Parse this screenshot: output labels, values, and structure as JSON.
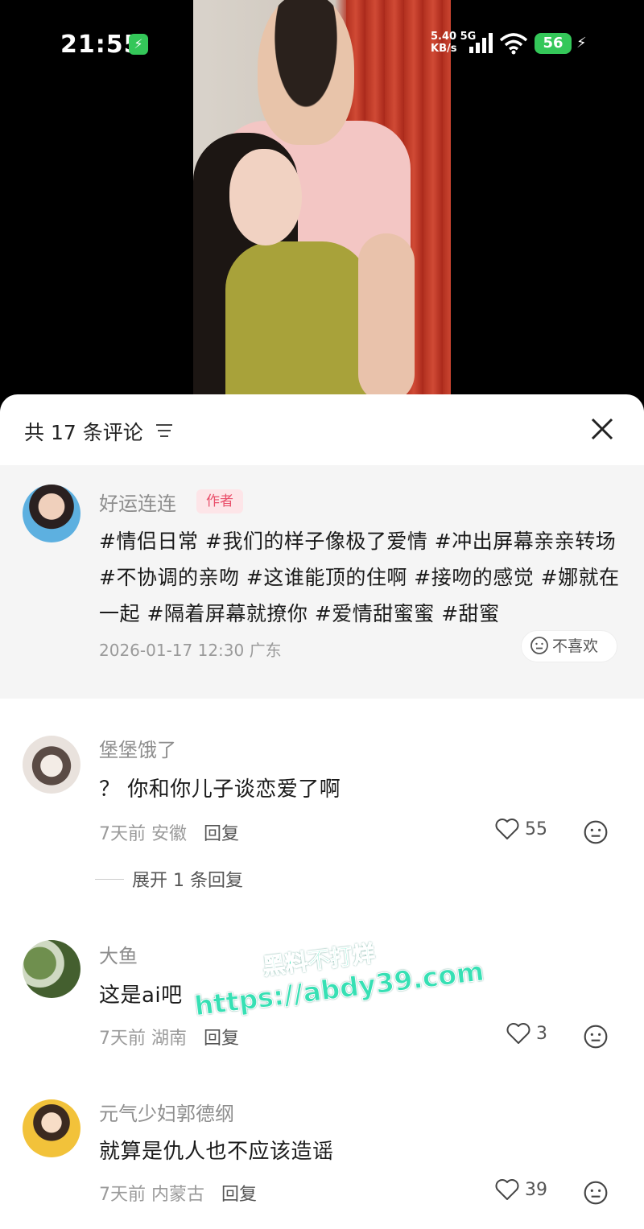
{
  "status_bar": {
    "time": "21:55",
    "charge_glyph": "⚡",
    "net_speed_value": "5.40",
    "net_speed_unit": "KB/s",
    "net_type": "5G",
    "battery": "56",
    "icons": [
      "charging-icon",
      "signal-icon",
      "wifi-icon",
      "battery-icon",
      "bolt-icon"
    ]
  },
  "video": {
    "description_icon": "video-frame"
  },
  "panel": {
    "title": "共 17 条评论",
    "sort_icon": "sort-icon",
    "close_icon": "close-icon"
  },
  "author_post": {
    "name": "好运连连",
    "badge": "作者",
    "text": "#情侣日常 #我们的样子像极了爱情 #冲出屏幕亲亲转场 #不协调的亲吻 #这谁能顶的住啊 #接吻的感觉 #娜就在一起 #隔着屏幕就撩你 #爱情甜蜜蜜 #甜蜜",
    "meta": "2026-01-17 12:30 广东",
    "dislike_label": "不喜欢"
  },
  "comments": [
    {
      "name": "堡堡饿了",
      "text": "？ 你和你儿子谈恋爱了啊",
      "time": "7天前",
      "location": "安徽",
      "reply_label": "回复",
      "likes": "55",
      "expand_label": "展开 1 条回复"
    },
    {
      "name": "大鱼",
      "text": "这是ai吧",
      "time": "7天前",
      "location": "湖南",
      "reply_label": "回复",
      "likes": "3"
    },
    {
      "name": "元气少妇郭德纲",
      "text": "就算是仇人也不应该造谣",
      "time": "7天前",
      "location": "内蒙古",
      "reply_label": "回复",
      "likes": "39"
    }
  ],
  "watermark": {
    "line1": "黑料不打烊",
    "line2": "https://abdy39.com"
  },
  "colors": {
    "accent_badge": "#e94e6a",
    "battery": "#34c759",
    "watermark": "#37e0b4"
  }
}
